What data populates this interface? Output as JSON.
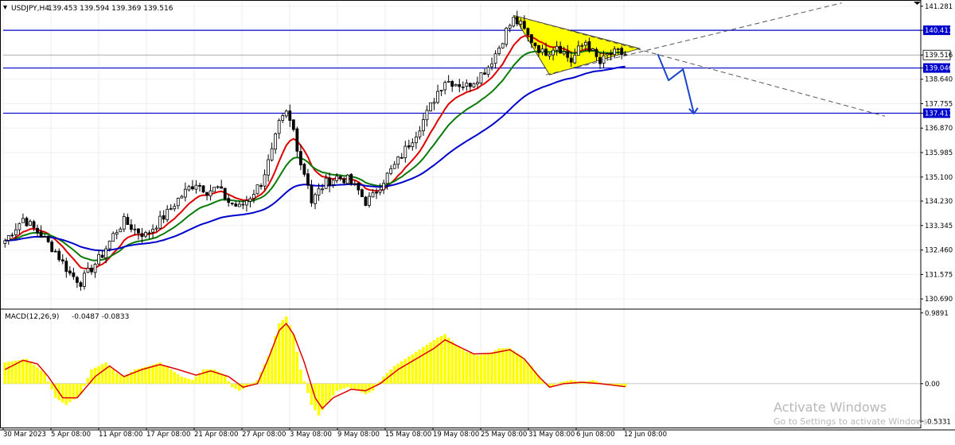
{
  "header": {
    "symbol": "USDJPY,H4",
    "ohlc": "139.453 139.594 139.369 139.516"
  },
  "watermark": {
    "title": "Activate Windows",
    "subtitle": "Go to Settings to activate Windows."
  },
  "chart_data": [
    {
      "type": "line",
      "subtype": "candlestick-with-moving-averages",
      "symbol": "USDJPY",
      "timeframe": "H4",
      "ylim": [
        130.35,
        141.42
      ],
      "y_ticks": [
        "141.281",
        "140.411",
        "139.516",
        "139.046",
        "138.640",
        "137.755",
        "137.411",
        "136.870",
        "135.985",
        "135.100",
        "134.230",
        "133.345",
        "132.460",
        "131.575",
        "130.690"
      ],
      "x_ticks": [
        "30 Mar 2023",
        "5 Apr 08:00",
        "11 Apr 08:00",
        "17 Apr 08:00",
        "21 Apr 08:00",
        "27 Apr 08:00",
        "3 May 08:00",
        "9 May 08:00",
        "15 May 08:00",
        "19 May 08:00",
        "25 May 08:00",
        "31 May 08:00",
        "6 Jun 08:00",
        "12 Jun 08:00"
      ],
      "price_levels": [
        {
          "value": 140.411,
          "label": "140.411",
          "color": "#0000cc"
        },
        {
          "value": 139.046,
          "label": "139.046",
          "color": "#0000cc"
        },
        {
          "value": 137.411,
          "label": "137.411",
          "color": "#0000cc"
        }
      ],
      "current_price": {
        "value": 139.516,
        "label": "139.516"
      },
      "close_path": [
        [
          0,
          132.8
        ],
        [
          5,
          133.6
        ],
        [
          10,
          133.0
        ],
        [
          14,
          132.4
        ],
        [
          18,
          131.6
        ],
        [
          21,
          131.3
        ],
        [
          24,
          131.8
        ],
        [
          27,
          132.3
        ],
        [
          30,
          133.0
        ],
        [
          33,
          133.5
        ],
        [
          36,
          133.2
        ],
        [
          39,
          133.0
        ],
        [
          42,
          133.4
        ],
        [
          45,
          133.8
        ],
        [
          48,
          134.3
        ],
        [
          51,
          134.7
        ],
        [
          53,
          134.9
        ],
        [
          56,
          134.6
        ],
        [
          59,
          134.7
        ],
        [
          62,
          134.2
        ],
        [
          65,
          134.0
        ],
        [
          68,
          134.4
        ],
        [
          71,
          134.9
        ],
        [
          74,
          136.0
        ],
        [
          76,
          137.0
        ],
        [
          78,
          137.4
        ],
        [
          80,
          136.8
        ],
        [
          82,
          135.6
        ],
        [
          84,
          134.9
        ],
        [
          85,
          134.2
        ],
        [
          87,
          134.6
        ],
        [
          89,
          134.9
        ],
        [
          92,
          135.1
        ],
        [
          95,
          135.0
        ],
        [
          98,
          134.6
        ],
        [
          100,
          134.2
        ],
        [
          102,
          134.4
        ],
        [
          105,
          135.0
        ],
        [
          108,
          135.5
        ],
        [
          111,
          136.1
        ],
        [
          114,
          136.7
        ],
        [
          117,
          137.4
        ],
        [
          120,
          138.2
        ],
        [
          122,
          138.6
        ],
        [
          125,
          138.5
        ],
        [
          128,
          138.4
        ],
        [
          131,
          138.7
        ],
        [
          134,
          139.1
        ],
        [
          137,
          139.8
        ],
        [
          139,
          140.4
        ],
        [
          141,
          140.8
        ],
        [
          143,
          140.6
        ],
        [
          145,
          140.2
        ],
        [
          147,
          139.9
        ],
        [
          149,
          139.6
        ],
        [
          151,
          139.7
        ],
        [
          153,
          139.9
        ],
        [
          155,
          139.6
        ],
        [
          157,
          139.3
        ],
        [
          159,
          139.7
        ],
        [
          161,
          140.0
        ],
        [
          163,
          139.6
        ],
        [
          165,
          139.2
        ],
        [
          167,
          139.5
        ],
        [
          170,
          139.6
        ],
        [
          173,
          139.5
        ]
      ],
      "series": [
        {
          "name": "",
          "color": "#dd0000",
          "length": 10
        },
        {
          "name": "",
          "color": "#0a7a0a",
          "length": 20
        },
        {
          "name": "",
          "color": "#0000cc",
          "length": 50
        }
      ],
      "annotations": [
        {
          "kind": "triangle",
          "color": "#ffff00",
          "points": [
            [
              141,
              140.95
            ],
            [
              176,
              139.75
            ],
            [
              151,
              138.8
            ]
          ]
        },
        {
          "kind": "dashed_line",
          "points": [
            [
              150,
              138.8
            ],
            [
              232,
              141.4
            ]
          ]
        },
        {
          "kind": "dashed_line",
          "points": [
            [
              141,
              140.95
            ],
            [
              244,
              137.3
            ]
          ]
        },
        {
          "kind": "arrow",
          "color": "#1a44cc",
          "points": [
            [
              181,
              139.55
            ],
            [
              184,
              138.6
            ],
            [
              188,
              139.0
            ],
            [
              191,
              137.4
            ]
          ]
        }
      ]
    },
    {
      "type": "bar",
      "title": "MACD(12,26,9)",
      "values_text": "-0.0487 -0.0833",
      "ylim": [
        -0.62,
        1.02
      ],
      "y_ticks": [
        "0.9891",
        "0.00",
        "-0.5331"
      ],
      "macd_path": [
        [
          0,
          0.3
        ],
        [
          6,
          0.35
        ],
        [
          11,
          0.15
        ],
        [
          14,
          -0.2
        ],
        [
          17,
          -0.3
        ],
        [
          21,
          -0.15
        ],
        [
          24,
          0.2
        ],
        [
          28,
          0.3
        ],
        [
          31,
          0.15
        ],
        [
          33,
          0.1
        ],
        [
          36,
          0.2
        ],
        [
          40,
          0.25
        ],
        [
          43,
          0.3
        ],
        [
          46,
          0.2
        ],
        [
          49,
          0.1
        ],
        [
          52,
          0.05
        ],
        [
          55,
          0.2
        ],
        [
          58,
          0.2
        ],
        [
          61,
          0.12
        ],
        [
          63,
          -0.05
        ],
        [
          65,
          -0.1
        ],
        [
          67,
          -0.05
        ],
        [
          70,
          0.05
        ],
        [
          74,
          0.5
        ],
        [
          76,
          0.85
        ],
        [
          78,
          0.95
        ],
        [
          80,
          0.7
        ],
        [
          82,
          0.2
        ],
        [
          85,
          -0.3
        ],
        [
          87,
          -0.45
        ],
        [
          89,
          -0.3
        ],
        [
          92,
          -0.1
        ],
        [
          95,
          -0.05
        ],
        [
          98,
          -0.1
        ],
        [
          100,
          -0.15
        ],
        [
          102,
          -0.1
        ],
        [
          105,
          0.1
        ],
        [
          108,
          0.25
        ],
        [
          111,
          0.35
        ],
        [
          114,
          0.45
        ],
        [
          117,
          0.55
        ],
        [
          120,
          0.65
        ],
        [
          122,
          0.7
        ],
        [
          125,
          0.55
        ],
        [
          128,
          0.45
        ],
        [
          131,
          0.4
        ],
        [
          134,
          0.42
        ],
        [
          137,
          0.5
        ],
        [
          140,
          0.5
        ],
        [
          143,
          0.4
        ],
        [
          146,
          0.25
        ],
        [
          149,
          0.05
        ],
        [
          151,
          -0.05
        ],
        [
          154,
          0.02
        ],
        [
          157,
          0.05
        ],
        [
          160,
          0.02
        ],
        [
          163,
          0.05
        ],
        [
          166,
          0.0
        ],
        [
          169,
          -0.03
        ],
        [
          173,
          -0.05
        ]
      ],
      "signal_path": [
        [
          0,
          0.2
        ],
        [
          5,
          0.33
        ],
        [
          9,
          0.28
        ],
        [
          12,
          0.1
        ],
        [
          16,
          -0.2
        ],
        [
          20,
          -0.2
        ],
        [
          25,
          0.1
        ],
        [
          29,
          0.25
        ],
        [
          33,
          0.1
        ],
        [
          38,
          0.2
        ],
        [
          43,
          0.27
        ],
        [
          48,
          0.2
        ],
        [
          53,
          0.12
        ],
        [
          57,
          0.18
        ],
        [
          62,
          0.1
        ],
        [
          66,
          -0.05
        ],
        [
          70,
          0.0
        ],
        [
          73,
          0.35
        ],
        [
          76,
          0.75
        ],
        [
          78,
          0.85
        ],
        [
          80,
          0.7
        ],
        [
          83,
          0.3
        ],
        [
          86,
          -0.2
        ],
        [
          88,
          -0.35
        ],
        [
          91,
          -0.2
        ],
        [
          96,
          -0.08
        ],
        [
          100,
          -0.1
        ],
        [
          104,
          0.0
        ],
        [
          109,
          0.2
        ],
        [
          114,
          0.35
        ],
        [
          119,
          0.5
        ],
        [
          122,
          0.62
        ],
        [
          126,
          0.52
        ],
        [
          130,
          0.42
        ],
        [
          135,
          0.43
        ],
        [
          140,
          0.48
        ],
        [
          144,
          0.35
        ],
        [
          148,
          0.1
        ],
        [
          151,
          -0.05
        ],
        [
          155,
          0.0
        ],
        [
          160,
          0.02
        ],
        [
          165,
          0.0
        ],
        [
          170,
          -0.03
        ],
        [
          173,
          -0.05
        ]
      ],
      "histogram_color": "#ffff00",
      "signal_color": "#dd0000"
    }
  ]
}
